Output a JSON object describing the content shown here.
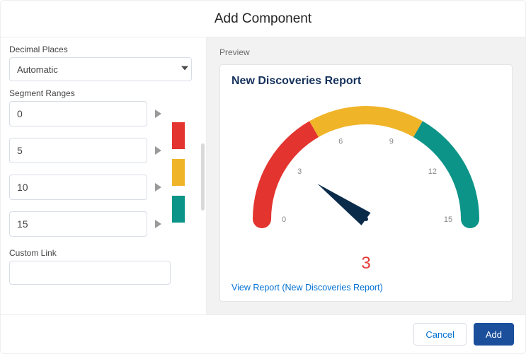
{
  "header": {
    "title": "Add Component"
  },
  "left": {
    "decimal_label": "Decimal Places",
    "decimal_value": "Automatic",
    "segment_label": "Segment Ranges",
    "segments": [
      "0",
      "5",
      "10",
      "15"
    ],
    "colors": [
      "#e3342f",
      "#f0b429",
      "#0d9488"
    ],
    "custom_link_label": "Custom Link",
    "custom_link_value": ""
  },
  "preview": {
    "label": "Preview",
    "title": "New Discoveries Report",
    "link": "View Report (New Discoveries Report)"
  },
  "footer": {
    "cancel": "Cancel",
    "add": "Add"
  },
  "chart_data": {
    "type": "gauge",
    "value": 3,
    "min": 0,
    "max": 15,
    "ticks": [
      0,
      3,
      6,
      9,
      12,
      15
    ],
    "segments": [
      {
        "from": 0,
        "to": 5,
        "color": "#e3342f"
      },
      {
        "from": 5,
        "to": 10,
        "color": "#f0b429"
      },
      {
        "from": 10,
        "to": 15,
        "color": "#0d9488"
      }
    ],
    "title": "New Discoveries Report"
  }
}
